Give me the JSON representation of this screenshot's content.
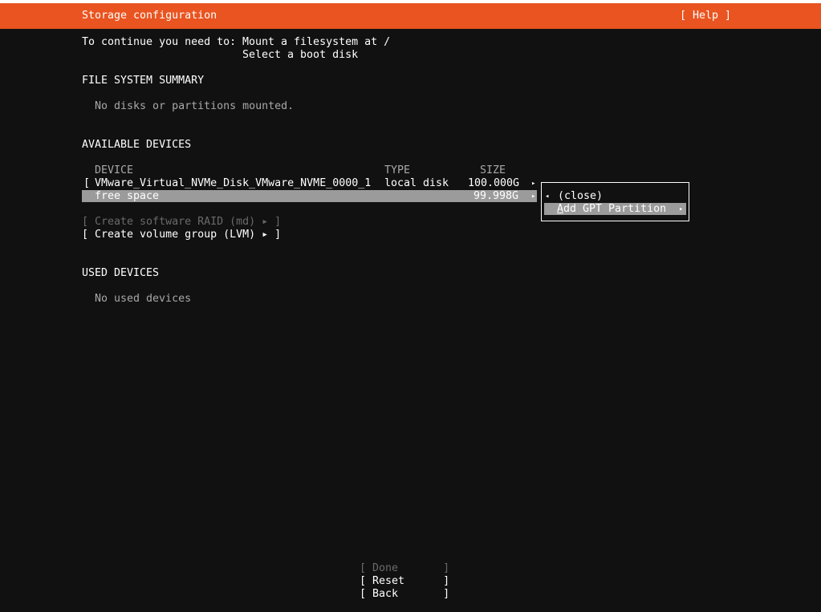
{
  "header": {
    "title": "Storage configuration",
    "help_label": "[ Help ]"
  },
  "intro": {
    "prefix": "To continue you need to:",
    "line1": "Mount a filesystem at /",
    "line2": "Select a boot disk"
  },
  "fs_summary": {
    "heading": "FILE SYSTEM SUMMARY",
    "empty_text": "No disks or partitions mounted."
  },
  "available": {
    "heading": "AVAILABLE DEVICES",
    "columns": {
      "device": "DEVICE",
      "type": "TYPE",
      "size": "SIZE"
    },
    "disk": {
      "bracket": "[",
      "name": "VMware_Virtual_NVMe_Disk_VMware_NVME_0000_1",
      "type": "local disk",
      "size": "100.000G"
    },
    "free_space": {
      "name": "free space",
      "size": "99.998G"
    },
    "create_raid": "[ Create software RAID (md) ▸ ]",
    "create_lvm": "[ Create volume group (LVM) ▸ ]"
  },
  "popup": {
    "close_label": "(close)",
    "add_gpt_first": "A",
    "add_gpt_rest": "dd GPT Partition"
  },
  "used": {
    "heading": "USED DEVICES",
    "empty_text": "No used devices"
  },
  "buttons": {
    "done": "[ Done       ]",
    "reset": "[ Reset      ]",
    "back": "[ Back       ]"
  },
  "glyphs": {
    "arrow_right": "▸",
    "arrow_left": "◂"
  },
  "colors": {
    "header_bg": "#e95420",
    "background": "#111111",
    "highlight": "#9b9b9b",
    "disabled_text": "#6a6a6a",
    "dim_text": "#a8a8a8"
  }
}
